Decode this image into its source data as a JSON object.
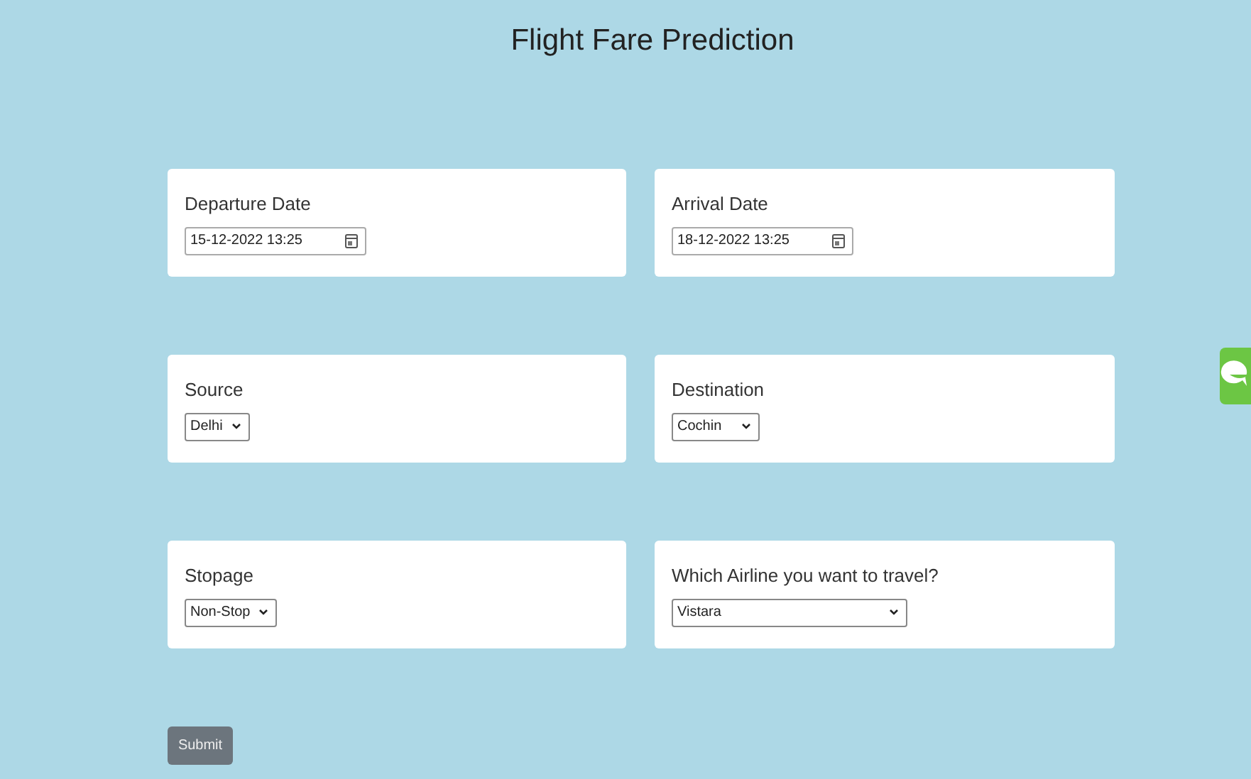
{
  "title": "Flight Fare Prediction",
  "fields": [
    {
      "kind": "datetime",
      "label": "Departure Date",
      "value": "15-12-2022 13:25"
    },
    {
      "kind": "datetime",
      "label": "Arrival Date",
      "value": "18-12-2022 13:25"
    },
    {
      "kind": "select",
      "label": "Source",
      "value": "Delhi"
    },
    {
      "kind": "select",
      "label": "Destination",
      "value": "Cochin"
    },
    {
      "kind": "select",
      "label": "Stopage",
      "value": "Non-Stop"
    },
    {
      "kind": "select",
      "label": "Which Airline you want to travel?",
      "value": "Vistara"
    }
  ],
  "submit": {
    "label": "Submit"
  }
}
